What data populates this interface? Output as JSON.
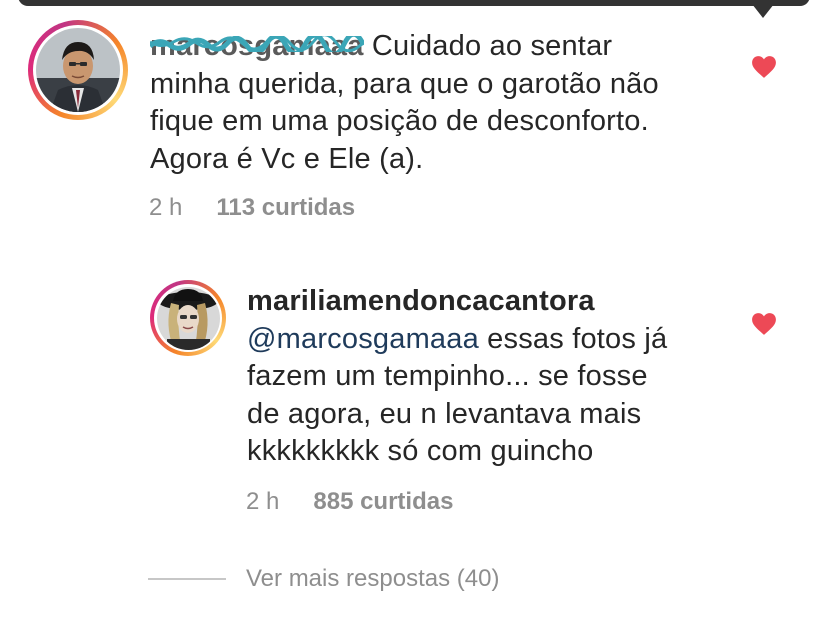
{
  "comment": {
    "username": "marcosgamaaa",
    "text_lines": [
      " Cuidado ao sentar",
      "minha querida, para que o garotão não",
      "fique em uma posição de desconforto.",
      "Agora é Vc e Ele (a)."
    ],
    "time": "2 h",
    "likes": "113 curtidas",
    "liked": true
  },
  "reply": {
    "username": "mariliamendoncacantora",
    "mention": "@marcosgamaaa",
    "text_lines": [
      " essas fotos já",
      "fazem um tempinho... se fosse",
      "de agora, eu n levantava mais",
      "kkkkkkkkk só com guincho"
    ],
    "time": "2 h",
    "likes": "885 curtidas",
    "liked": true
  },
  "more_replies": "Ver mais respostas (40)",
  "colors": {
    "heart": "#ed4956",
    "meta": "#8e8e8e",
    "text": "#262626",
    "squiggle": "#3ba6b7"
  },
  "icons": {
    "heart": "heart-filled-icon"
  }
}
